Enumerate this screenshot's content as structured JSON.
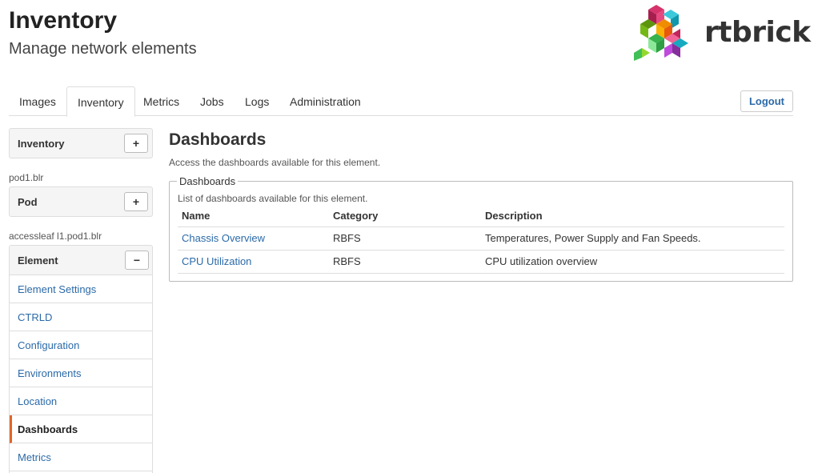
{
  "header": {
    "title": "Inventory",
    "subtitle": "Manage network elements",
    "logo_text": "rtbrick"
  },
  "tabs": [
    {
      "label": "Images",
      "active": false
    },
    {
      "label": "Inventory",
      "active": true
    },
    {
      "label": "Metrics",
      "active": false
    },
    {
      "label": "Jobs",
      "active": false
    },
    {
      "label": "Logs",
      "active": false
    },
    {
      "label": "Administration",
      "active": false
    }
  ],
  "logout_label": "Logout",
  "sidebar": {
    "inventory": {
      "label": "Inventory",
      "button": "+"
    },
    "pod_crumb": "pod1.blr",
    "pod": {
      "label": "Pod",
      "button": "+"
    },
    "element_crumb": "accessleaf l1.pod1.blr",
    "element": {
      "label": "Element",
      "button": "−"
    },
    "items": [
      {
        "label": "Element Settings",
        "active": false
      },
      {
        "label": "CTRLD",
        "active": false
      },
      {
        "label": "Configuration",
        "active": false
      },
      {
        "label": "Environments",
        "active": false
      },
      {
        "label": "Location",
        "active": false
      },
      {
        "label": "Dashboards",
        "active": true
      },
      {
        "label": "Metrics",
        "active": false
      }
    ]
  },
  "main": {
    "title": "Dashboards",
    "description": "Access the dashboards available for this element.",
    "fieldset": {
      "legend": "Dashboards",
      "description": "List of dashboards available for this element.",
      "columns": [
        "Name",
        "Category",
        "Description"
      ],
      "rows": [
        {
          "name": "Chassis Overview",
          "category": "RBFS",
          "description": "Temperatures, Power Supply and Fan Speeds."
        },
        {
          "name": "CPU Utilization",
          "category": "RBFS",
          "description": "CPU utilization overview"
        }
      ]
    }
  },
  "colors": {
    "link": "#2b6aa8",
    "active_indicator": "#e0652b",
    "border": "#dddddd",
    "panel_bg": "#f5f5f5"
  }
}
